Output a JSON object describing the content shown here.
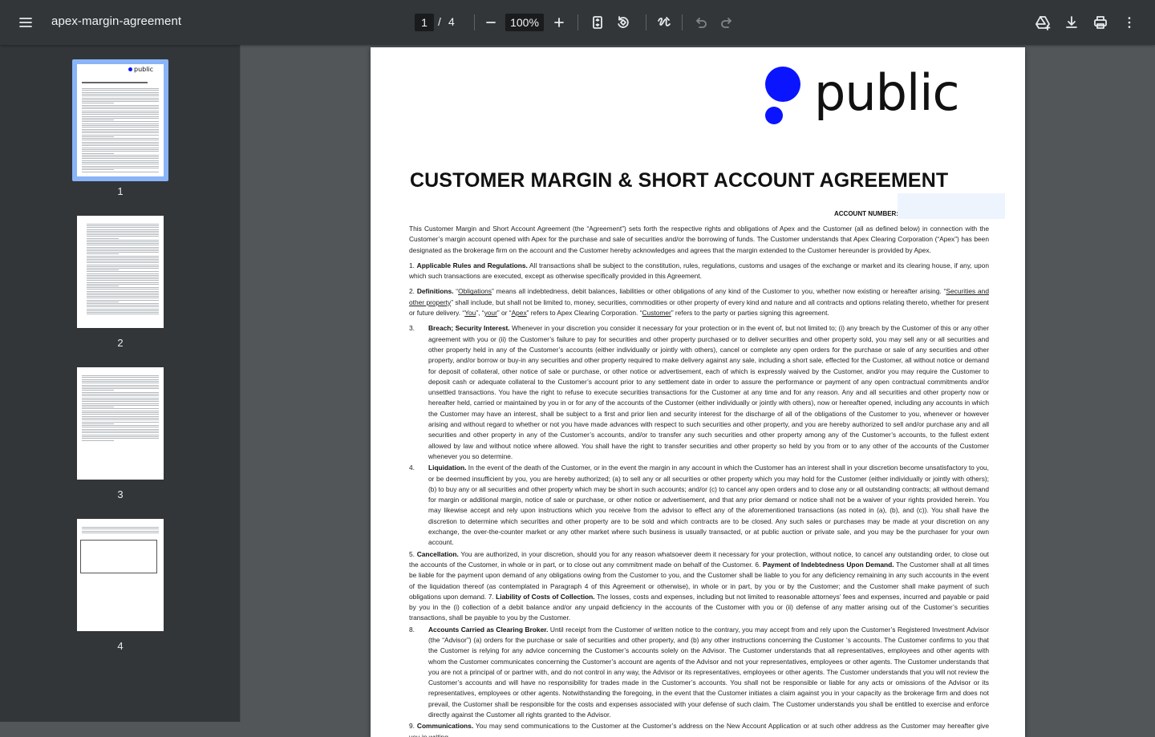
{
  "toolbar": {
    "title": "apex-margin-agreement",
    "current_page": "1",
    "page_separator": "/",
    "total_pages": "4",
    "zoom": "100%"
  },
  "thumbnails": [
    {
      "label": "1",
      "selected": true
    },
    {
      "label": "2",
      "selected": false
    },
    {
      "label": "3",
      "selected": false
    },
    {
      "label": "4",
      "selected": false
    }
  ],
  "document": {
    "logo_text": "public",
    "title": "CUSTOMER MARGIN & SHORT ACCOUNT AGREEMENT",
    "account_number_label": "ACCOUNT NUMBER:",
    "intro": "This Customer Margin and Short Account Agreement (the “Agreement”) sets forth the respective rights and obligations of Apex and the Customer (all as defined below) in connection with the Customer’s margin account opened with Apex for the purchase and sale of securities and/or the borrowing of funds. The Customer understands that Apex Clearing Corporation (“Apex”) has been designated as the brokerage firm on the account and the Customer hereby acknowledges and agrees that the margin extended to the Customer hereunder is provided by Apex.",
    "s1_num": "1.",
    "s1_head": "Applicable Rules and Regulations.",
    "s1_text": " All transactions shall be subject to the constitution, rules, regulations, customs and usages of the exchange or market and its clearing house, if any, upon which such transactions are executed, except as otherwise specifically provided in this Agreement.",
    "s2_num": "2.",
    "s2_head": "Definitions.",
    "s2_a": "  “",
    "s2_obl": "Obligations",
    "s2_b": "” means all indebtedness, debit balances, liabilities or other obligations of any kind of the Customer to you, whether now existing or hereafter arising. “",
    "s2_sec": "Securities and other property",
    "s2_c": "” shall include, but shall not be limited to, money, securities, commodities or other property of every kind and nature and all contracts and options relating thereto, whether for present or future delivery. “",
    "s2_you": "You",
    "s2_d": "”, “",
    "s2_your": "your",
    "s2_e": "” or “",
    "s2_apex": "Apex",
    "s2_f": "” refers to Apex Clearing Corporation. “",
    "s2_cust": "Customer",
    "s2_g": "” refers to the party or parties signing this agreement.",
    "s3_num": "3.",
    "s3_head": "Breach; Security Interest.",
    "s3_text": " Whenever in your discretion you consider it necessary for your protection  or in the event of, but not limited to; (i) any breach by the Customer of this or any other agreement with you or (ii) the Customer’s failure to pay for securities and  other property purchased or to deliver securities and other property sold, you may sell any or all securities and other property held in any of the Customer’s  accounts (either individually or jointly with others), cancel or complete any open orders for the purchase or sale of any securities and other property, and/or  borrow or buy-in any securities and other property required to make delivery against any sale, including a short sale, effected for the Customer, all without notice  or demand for deposit of collateral, other notice of sale or purchase, or other notice or advertisement, each of which is expressly waived by the Customer, and/or  you may require the Customer to deposit cash or adequate collateral to the Customer’s account prior to any settlement date in order to assure the performance  or payment of any open contractual commitments and/or unsettled transactions. You have the right to refuse to execute securities transactions for the Customer at any time and for any reason. Any and all securities and other property now or hereafter held, carried or maintained by you in or for any of the accounts of the  Customer (either individually or jointly with others), now or hereafter opened, including any accounts in which the Customer may have an interest, shall be subject  to a first and prior lien and security interest for the discharge of all of the obligations of the Customer to you, whenever or however arising and without regard to  whether or not you have made advances with respect to such securities and other property, and you are hereby authorized to sell and/or purchase any and all  securities and other property in any of the Customer’s accounts, and/or to transfer any such securities and other property among any of the Customer’s accounts,  to the fullest extent allowed by law and without notice where allowed. You shall have the right to transfer securities and other property so held by you from or to any other of the accounts of the Customer whenever you so determine.",
    "s4_num": "4.",
    "s4_head": "Liquidation.",
    "s4_text": " In the event of the death of the Customer, or in the event the margin in any account in which the Customer has an interest shall in your discretion become unsatisfactory to you, or be deemed insufficient by you,  you are hereby authorized; (a) to sell any or all securities or other property which you may hold for the Customer (either individually or jointly with others); (b) to  buy any or all securities and other property which may be short in such accounts; and/or (c) to cancel any open orders and to close any or all outstanding contracts;  all without demand for margin or additional margin, notice of sale or purchase, or other notice or advertisement, and that any prior demand or notice shall not  be a waiver of your rights provided herein. You may likewise accept and rely upon instructions which you receive from the advisor to effect any of the aforementioned transactions (as noted in (a), (b), and (c)). You shall have the discretion to determine which securities and other property are to be sold and which contracts are to be closed. Any such sales or purchases may be made at your discretion on any exchange, the over-the-counter market or any other market where such business is usually transacted, or at public auction or private sale, and you may be the purchaser for your own account.",
    "s5_num": "5.",
    "s5_head": "Cancellation.",
    "s5_text": " You are authorized, in your discretion, should you for any reason whatsoever deem it necessary for your protection, without notice, to cancel any outstanding order, to close out the accounts of the Customer, in whole or in part, or to close out any commitment made on behalf of the Customer. 6. ",
    "s6_head": "Payment of Indebtedness Upon Demand.",
    "s6_text": " The Customer shall at all times be liable for the payment upon demand of any obligations owing from the Customer to  you, and the Customer shall be liable to you for any deficiency remaining in any such accounts in the event of the liquidation thereof (as contemplated in Paragraph  4 of this Agreement or otherwise), in whole or in part, by you or by the Customer; and the Customer shall make payment of such obligations upon demand. 7. ",
    "s7_head": "Liability of Costs of Collection.",
    "s7_text": " The losses, costs and expenses, including but not limited to reasonable attorneys’ fees and expenses, incurred and payable or paid by you in the (i) collection of a debit balance and/or any unpaid deficiency in the accounts of the Customer with you or (ii) defense of any matter arising out of  the Customer’s securities transactions, shall be payable to you by the Customer.",
    "s8_num": "8.",
    "s8_head": "Accounts Carried as Clearing Broker.",
    "s8_text": " Until receipt from the Customer of written  notice to the contrary, you may accept from and rely upon the Customer’s Registered Investment Advisor (the “Advisor”) (a) orders for the purchase or sale of securities and other property,  and (b) any other instructions concerning the Customer ‘s accounts. The Customer confirms to you that the Customer is relying for any advice concerning the Customer’s accounts solely on the Advisor. The Customer understands that all  representatives, employees and other agents with whom the Customer communicates concerning the Customer’s account are agents of the Advisor and not your representatives, employees or other agents. The Customer understands that you are not a principal of or partner with, and do not control in any  way, the Advisor or its representatives, employees or other agents. The Customer understands that you will not review the Customer’s accounts and will have no responsibility for trades made in the Customer’s accounts. You shall not be responsible or liable for any acts or omissions of the Advisor  or its representatives, employees or other agents. Notwithstanding the foregoing, in the event that the Customer initiates a claim against you in your capacity as  the brokerage firm and does not prevail, the Customer shall be responsible for the costs and expenses associated with your defense of such claim. The Customer  understands you shall be entitled to exercise and enforce directly against the Customer all rights granted to the Advisor.",
    "s9_num": "9.",
    "s9_head": "Communications.",
    "s9_text": " You may send communications to the Customer at the Customer’s address on the New Account Application or at such other address as the Customer may hereafter give you in writing."
  },
  "icons": [
    "menu-icon",
    "minus-icon",
    "plus-icon",
    "fit-page-icon",
    "rotate-icon",
    "annotate-icon",
    "undo-icon",
    "redo-icon",
    "drive-add-icon",
    "download-icon",
    "print-icon",
    "more-vert-icon"
  ],
  "colors": {
    "toolbar": "#323639",
    "background": "#525659",
    "selected_thumb": "#8ab4f8",
    "logo_blue": "#0a14ff"
  }
}
